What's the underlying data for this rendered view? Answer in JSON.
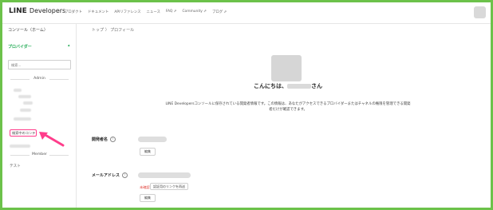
{
  "header": {
    "logo_main": "LINE",
    "logo_sub": "Developers",
    "nav": [
      "プロダクト",
      "ドキュメント",
      "APIリファレンス",
      "ニュース",
      "FAQ ⇗",
      "Community ⇗",
      "ブログ ⇗"
    ]
  },
  "sidebar": {
    "console": "コンソール（ホーム）",
    "provider": "プロバイダー",
    "provider_chevron": "▴",
    "search_placeholder": "検索...",
    "admin_label": "Admin",
    "highlighted_item": "検索中のコンテ",
    "member_label": "Member",
    "test_item": "テスト",
    "accent_color": "#1ba84f",
    "highlight_color": "#ff3d8b"
  },
  "main": {
    "breadcrumb": "トップ 〉 プロフィール",
    "greeting_prefix": "こんにちは、",
    "greeting_suffix": "さん",
    "description": "LINE Developersコンソールに保存されている開発者情報です。この情報は、あなたがアクセスできるプロバイダーまたはチャネルの権限を管理できる開発者だけが確認できます。",
    "dev_name_label": "開発者名",
    "help_glyph": "?",
    "edit_label": "編集",
    "email_label": "メールアドレス",
    "unverified_label": "未確認",
    "resend_label": "認証用のリンクを再送",
    "edit_label_2": "編集"
  }
}
